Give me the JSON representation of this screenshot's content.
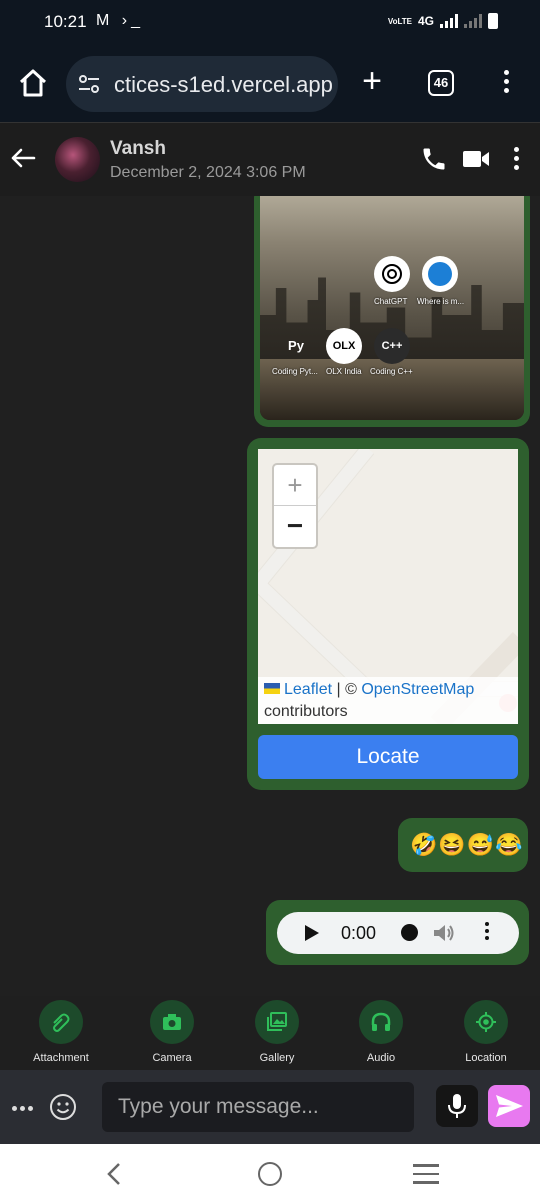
{
  "status": {
    "time": "10:21",
    "notif_icons": "M ›_",
    "network": "4G",
    "volte": "VoLTE"
  },
  "browser": {
    "url": "ctices-s1ed.vercel.app",
    "tab_count": "46"
  },
  "chat": {
    "contact_name": "Vansh",
    "last_seen": "December 2, 2024 3:06 PM"
  },
  "messages": {
    "image_apps": [
      {
        "label": "ChatGPT",
        "icon": "chatgpt-icon",
        "glyph": ""
      },
      {
        "label": "Where is m...",
        "icon": "train-icon",
        "glyph": ""
      },
      {
        "label": "Coding Pyt...",
        "icon": "python-coding-icon",
        "glyph": "Py"
      },
      {
        "label": "OLX India",
        "icon": "olx-icon",
        "glyph": "OLX"
      },
      {
        "label": "Coding C++",
        "icon": "cpp-coding-icon",
        "glyph": "C++"
      }
    ],
    "map": {
      "zoom_in": "+",
      "zoom_out": "−",
      "attribution_leaflet": "Leaflet",
      "attribution_sep": " | © ",
      "attribution_osm": "OpenStreetMap",
      "attribution_tail": "contributors",
      "locate_label": "Locate"
    },
    "emoji_text": "🤣😆😅😂",
    "audio": {
      "time": "0:00"
    }
  },
  "attachments": [
    {
      "label": "Attachment",
      "icon": "paperclip-icon"
    },
    {
      "label": "Camera",
      "icon": "camera-icon"
    },
    {
      "label": "Gallery",
      "icon": "gallery-icon"
    },
    {
      "label": "Audio",
      "icon": "headphones-icon"
    },
    {
      "label": "Location",
      "icon": "location-icon"
    }
  ],
  "composer": {
    "placeholder": "Type your message..."
  },
  "colors": {
    "bubble": "#2e5f2e",
    "accent_green": "#1d4a2b",
    "send": "#e879f0",
    "locate": "#3b7ff0"
  }
}
